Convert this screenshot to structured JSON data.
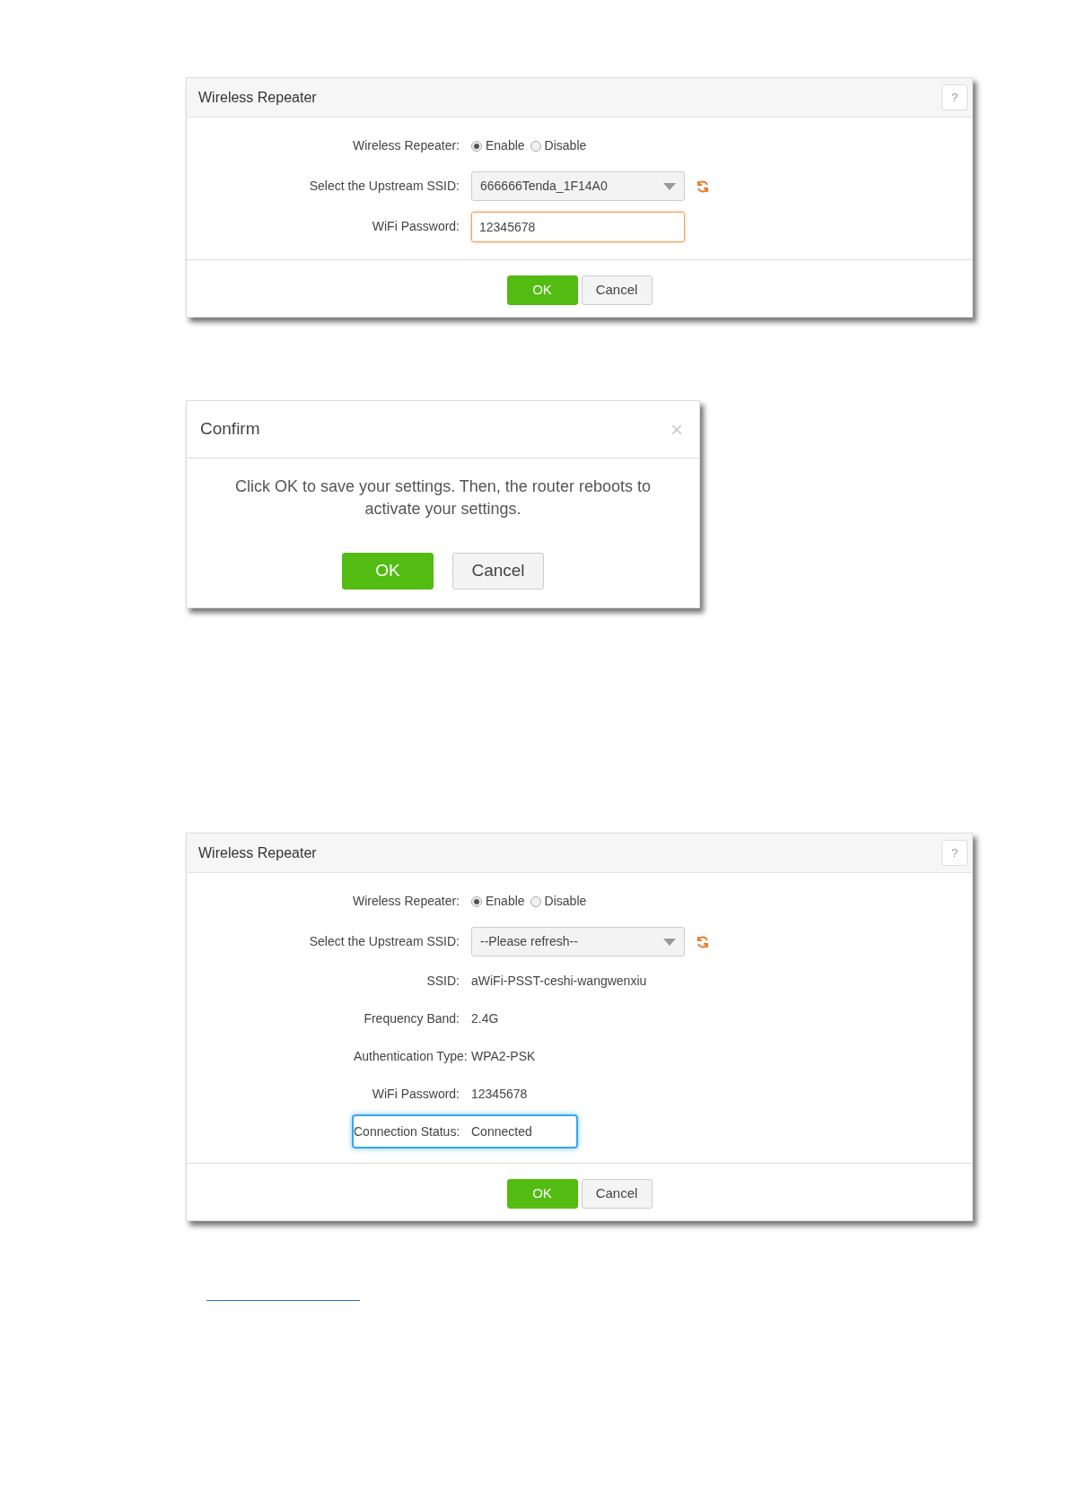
{
  "dialogs": [
    {
      "kind": "settings",
      "title": "Wireless Repeater",
      "help": "?",
      "rows": [
        {
          "kind": "radio",
          "label": "Wireless Repeater:",
          "options": [
            {
              "label": "Enable",
              "selected": true
            },
            {
              "label": "Disable",
              "selected": false
            }
          ]
        },
        {
          "kind": "select",
          "label": "Select the Upstream SSID:",
          "value": "666666Tenda_1F14A0"
        },
        {
          "kind": "input",
          "label": "WiFi Password:",
          "value": "12345678",
          "focused": true
        }
      ],
      "buttons": [
        {
          "label": "OK",
          "primary": true
        },
        {
          "label": "Cancel",
          "primary": false
        }
      ]
    },
    {
      "kind": "confirm",
      "title": "Confirm",
      "close": "×",
      "message": "Click OK to save your settings. Then, the router reboots to activate your settings.",
      "buttons": [
        {
          "label": "OK",
          "primary": true
        },
        {
          "label": "Cancel",
          "primary": false
        }
      ]
    },
    {
      "kind": "settings",
      "title": "Wireless Repeater",
      "help": "?",
      "rows": [
        {
          "kind": "radio",
          "label": "Wireless Repeater:",
          "options": [
            {
              "label": "Enable",
              "selected": true
            },
            {
              "label": "Disable",
              "selected": false
            }
          ]
        },
        {
          "kind": "select",
          "label": "Select the Upstream SSID:",
          "value": "--Please refresh--"
        },
        {
          "kind": "text",
          "label": "SSID:",
          "value": "aWiFi-PSST-ceshi-wangwenxiu",
          "highlighted": false
        },
        {
          "kind": "text",
          "label": "Frequency Band:",
          "value": "2.4G",
          "highlighted": false
        },
        {
          "kind": "text",
          "label": "Authentication Type:",
          "value": "WPA2-PSK",
          "highlighted": false
        },
        {
          "kind": "text",
          "label": "WiFi Password:",
          "value": "12345678",
          "highlighted": false
        },
        {
          "kind": "text",
          "label": "Connection Status:",
          "value": "Connected",
          "highlighted": true
        }
      ],
      "buttons": [
        {
          "label": "OK",
          "primary": true
        },
        {
          "label": "Cancel",
          "primary": false
        }
      ]
    }
  ]
}
